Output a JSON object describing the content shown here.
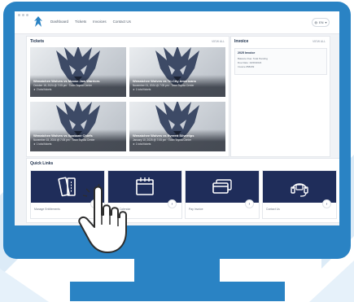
{
  "navbar": {
    "items": [
      "Dashboard",
      "Tickets",
      "Invoices",
      "Contact Us"
    ],
    "language": "EN"
  },
  "tickets_panel": {
    "title": "Tickets",
    "view_all": "VIEW ALL",
    "items": [
      {
        "title": "Wenatchee Wolves vs Moose Jaw Warriors",
        "date": "October 18, 2024 @ 7:05 pm · Town Toyota Center",
        "count": "★ 2 total tickets"
      },
      {
        "title": "Wenatchee Wolves vs Tri-City Americans",
        "date": "November 01, 2024 @ 7:05 pm · Town Toyota Center",
        "count": "★ 1 total tickets"
      },
      {
        "title": "Wenatchee Wolves vs Spokane Chiefs",
        "date": "November 15, 2024 @ 7:05 pm · Town Toyota Center",
        "count": "★ 1 total tickets"
      },
      {
        "title": "Wenatchee Wolves vs Everett Silvertips",
        "date": "January 10, 2025 @ 7:05 pm · Town Toyota Center",
        "count": "★ 1 total tickets"
      }
    ]
  },
  "invoice_panel": {
    "title": "Invoice",
    "view_all": "VIEW ALL",
    "card": {
      "title": "2025 Invoice",
      "lines": [
        "Balance Due: Total Pending",
        "Due Date: 10/29/2024",
        "Invoice #58209"
      ]
    }
  },
  "quick_links": {
    "title": "Quick Links",
    "items": [
      {
        "label": "Manage Entitlements",
        "icon": "tickets-icon"
      },
      {
        "label": "Event Calendar",
        "icon": "calendar-icon"
      },
      {
        "label": "Pay Invoice",
        "icon": "credit-card-icon"
      },
      {
        "label": "Contact Us",
        "icon": "headset-icon"
      }
    ]
  },
  "colors": {
    "monitor": "#2a83c4",
    "navy": "#1f2d5a",
    "screen_bg": "#f1f3f6"
  }
}
